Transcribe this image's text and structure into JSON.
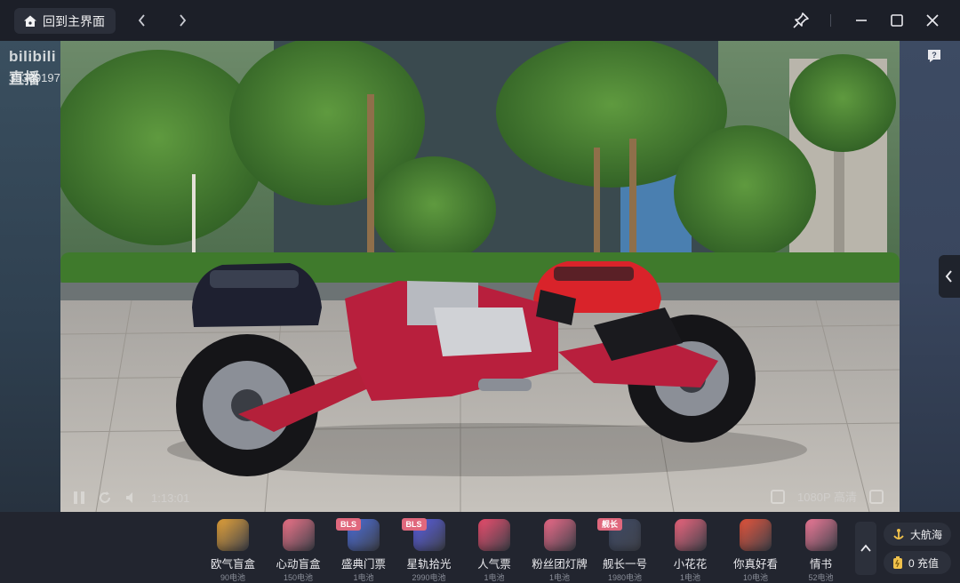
{
  "titlebar": {
    "home_label": "回到主界面"
  },
  "player": {
    "logo": "bilibili 直播",
    "room_id": "353801975",
    "controls_left": "1:13:01",
    "controls_right": "1080P 高清"
  },
  "gifts": [
    {
      "name": "欧气盲盒",
      "price": "90电池",
      "badge": "",
      "color": "#e7a43a"
    },
    {
      "name": "心动盲盒",
      "price": "150电池",
      "badge": "",
      "color": "#f1748a"
    },
    {
      "name": "盛典门票",
      "price": "1电池",
      "badge": "BLS",
      "color": "#4c6fe0"
    },
    {
      "name": "星轨拾光",
      "price": "2990电池",
      "badge": "BLS",
      "color": "#5a5fe8"
    },
    {
      "name": "人气票",
      "price": "1电池",
      "badge": "",
      "color": "#ef4e6f"
    },
    {
      "name": "粉丝团灯牌",
      "price": "1电池",
      "badge": "",
      "color": "#f06b8a"
    },
    {
      "name": "舰长一号",
      "price": "1980电池",
      "badge": "舰长",
      "color": "#3e4a66"
    },
    {
      "name": "小花花",
      "price": "1电池",
      "badge": "",
      "color": "#f0667f"
    },
    {
      "name": "你真好看",
      "price": "10电池",
      "badge": "",
      "color": "#e8553c"
    },
    {
      "name": "情书",
      "price": "52电池",
      "badge": "",
      "color": "#f27b9a"
    }
  ],
  "side": {
    "captain_label": "大航海",
    "recharge_label": "0 充值"
  },
  "colors": {
    "titlebar_bg": "#1c1f28",
    "giftbar_bg": "#22252f",
    "badge": "#e0687d"
  }
}
